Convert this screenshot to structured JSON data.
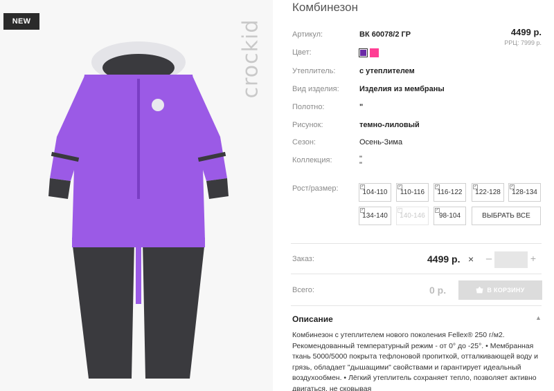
{
  "badge": "NEW",
  "brand": "crockid",
  "product": {
    "title": "Комбинезон",
    "price": "4499 р.",
    "rrp": "РРЦ: 7999 р."
  },
  "attributes": [
    {
      "label": "Артикул:",
      "value": "ВК 60078/2 ГР"
    },
    {
      "label": "Цвет:",
      "value": ""
    },
    {
      "label": "Утеплитель:",
      "value": "с утеплителем"
    },
    {
      "label": "Вид изделия:",
      "value": "Изделия из мембраны"
    },
    {
      "label": "Полотно:",
      "value": "\""
    },
    {
      "label": "Рисунок:",
      "value": "темно-лиловый"
    },
    {
      "label": "Сезон:",
      "value": "Осень-Зима"
    },
    {
      "label": "Коллекция:",
      "value": "\"\n\""
    }
  ],
  "colors": [
    {
      "name": "violet-swatch",
      "hex": "#6a2aa6",
      "selected": true
    },
    {
      "name": "pink-swatch",
      "hex": "#ff3e94",
      "selected": false
    }
  ],
  "sizes": {
    "label": "Рост/размер:",
    "options": [
      {
        "label": "104-110",
        "disabled": false
      },
      {
        "label": "110-116",
        "disabled": false
      },
      {
        "label": "116-122",
        "disabled": false
      },
      {
        "label": "122-128",
        "disabled": false
      },
      {
        "label": "128-134",
        "disabled": false
      },
      {
        "label": "134-140",
        "disabled": false
      },
      {
        "label": "140-146",
        "disabled": true
      },
      {
        "label": "98-104",
        "disabled": false
      }
    ],
    "select_all": "ВЫБРАТЬ ВСЕ"
  },
  "order": {
    "label": "Заказ:",
    "price": "4499 р.",
    "times": "×",
    "minus": "–",
    "plus": "+",
    "qty": ""
  },
  "total": {
    "label": "Всего:",
    "value": "0 р.",
    "cart_button": "В КОРЗИНУ"
  },
  "description": {
    "title": "Описание",
    "text": "Комбинезон с утеплителем нового поколения Fellex® 250 г/м2. Рекомендованный температурный режим - от 0° до -25°. • Мембранная ткань 5000/5000 покрыта тефлоновой пропиткой, отталкивающей воду и грязь, обладает \"дышащими\" свойствами и гарантирует идеальный воздухообмен. • Лёгкий утеплитель сохраняет тепло, позволяет активно двигаться, не сковывая"
  },
  "colors_theme": {
    "accent": "#6a2aa6",
    "cart_disabled": "#dcdcdc",
    "badge_bg": "#2b2b2b"
  }
}
